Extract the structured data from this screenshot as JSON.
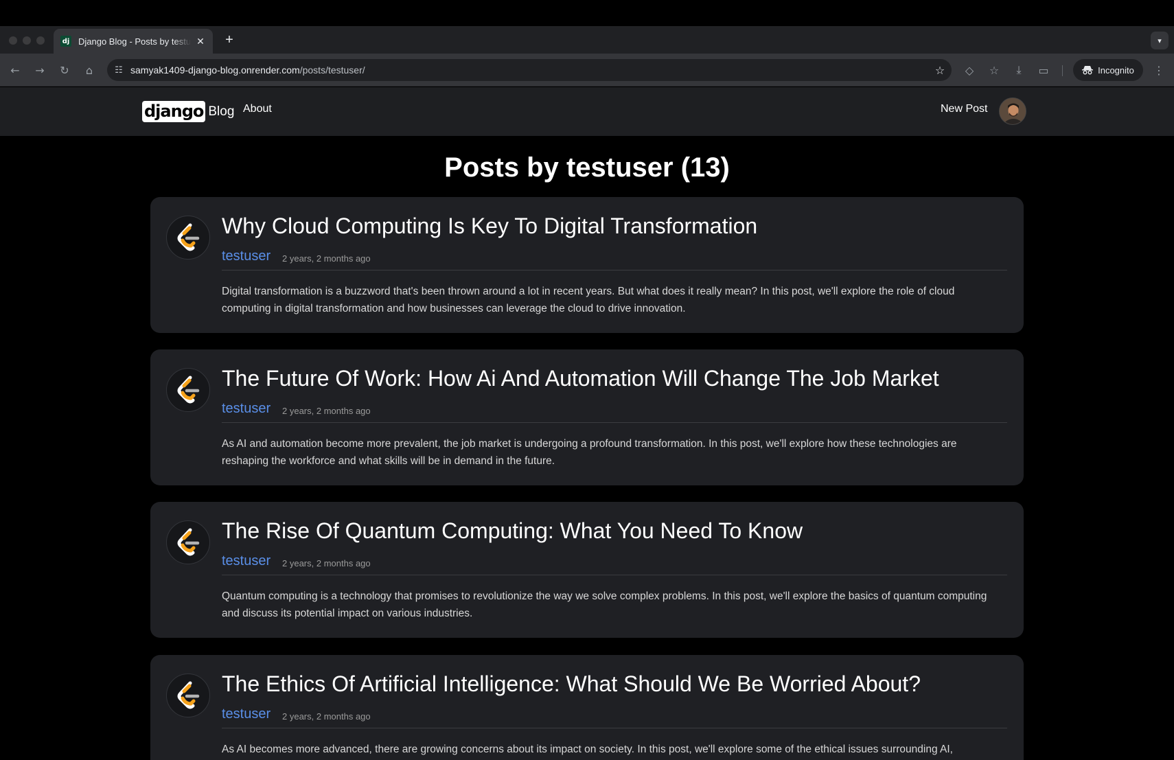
{
  "browser": {
    "tab_title": "Django Blog - Posts by testuser",
    "tab_favicon": "dj",
    "url_domain": "samyak1409-django-blog.onrender.com",
    "url_path": "/posts/testuser/",
    "incognito_label": "Incognito"
  },
  "site": {
    "logo_text": "django",
    "logo_suffix": "Blog",
    "nav_about": "About",
    "nav_new_post": "New Post"
  },
  "page": {
    "title": "Posts by testuser (13)"
  },
  "posts": [
    {
      "title": "Why Cloud Computing Is Key To Digital Transformation",
      "author": "testuser",
      "date": "2 years, 2 months ago",
      "excerpt": "Digital transformation is a buzzword that's been thrown around a lot in recent years. But what does it really mean? In this post, we'll explore the role of cloud computing in digital transformation and how businesses can leverage the cloud to drive innovation."
    },
    {
      "title": "The Future Of Work: How Ai And Automation Will Change The Job Market",
      "author": "testuser",
      "date": "2 years, 2 months ago",
      "excerpt": "As AI and automation become more prevalent, the job market is undergoing a profound transformation. In this post, we'll explore how these technologies are reshaping the workforce and what skills will be in demand in the future."
    },
    {
      "title": "The Rise Of Quantum Computing: What You Need To Know",
      "author": "testuser",
      "date": "2 years, 2 months ago",
      "excerpt": "Quantum computing is a technology that promises to revolutionize the way we solve complex problems. In this post, we'll explore the basics of quantum computing and discuss its potential impact on various industries."
    },
    {
      "title": "The Ethics Of Artificial Intelligence: What Should We Be Worried About?",
      "author": "testuser",
      "date": "2 years, 2 months ago",
      "excerpt": "As AI becomes more advanced, there are growing concerns about its impact on society. In this post, we'll explore some of the ethical issues surrounding AI,"
    }
  ],
  "colors": {
    "background": "#000000",
    "navbar": "#1e1f22",
    "card": "#1f2024",
    "author_link": "#5a8fe8",
    "logo_orange": "#f6a21a"
  },
  "icons": {
    "post_thumbnail": "leetcode-logo-icon",
    "avatar": "user-avatar"
  }
}
